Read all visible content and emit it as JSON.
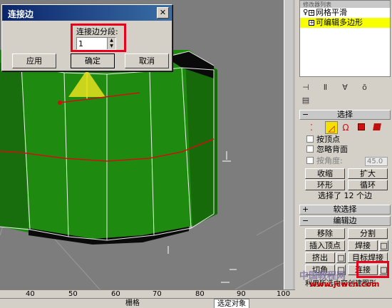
{
  "dialog": {
    "title": "连接边",
    "segments_label": "连接边分段:",
    "segments_value": "1",
    "apply": "应用",
    "ok": "确定",
    "cancel": "取消"
  },
  "modifier_stack": {
    "header": "修改器列表",
    "items": [
      {
        "label": "网格平滑",
        "selected": false
      },
      {
        "label": "可编辑多边形",
        "selected": true
      }
    ]
  },
  "selection_rollout": {
    "title": "选择",
    "by_vertex": "按顶点",
    "ignore_backfacing": "忽略背面",
    "by_angle": "按角度:",
    "angle_value": "45.0",
    "shrink": "收缩",
    "grow": "扩大",
    "ring": "环形",
    "loop": "循环",
    "status": "选择了 12 个边"
  },
  "soft_selection": {
    "title": "软选择"
  },
  "edit_edges": {
    "title": "编辑边",
    "remove": "移除",
    "split": "分割",
    "insert_vertex": "插入顶点",
    "weld": "焊接",
    "extrude": "挤出",
    "target_weld": "目标焊接",
    "chamfer": "切角",
    "connect": "连接",
    "create_shape": "利用所选内容创建图形"
  },
  "ruler": {
    "ticks": [
      "40",
      "50",
      "60",
      "70",
      "80",
      "90",
      "100"
    ]
  },
  "statusbar": {
    "snap": "栅格",
    "filter": "选定对象"
  },
  "watermark": {
    "site": "中国教程网",
    "url": "www.jcwcn.com"
  },
  "colors": {
    "highlight": "#e8001c",
    "object_green": "#1f8a10",
    "selected_row": "#f7ff00"
  }
}
